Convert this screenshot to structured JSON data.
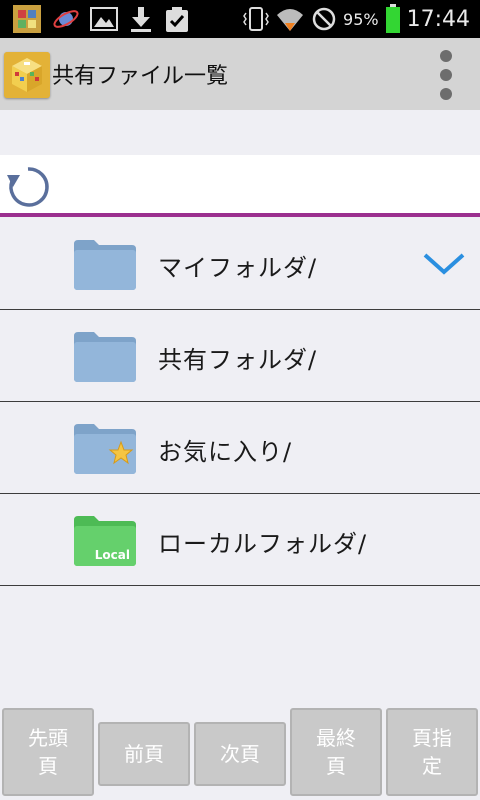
{
  "status": {
    "battery_pct": "95%",
    "time": "17:44"
  },
  "header": {
    "title": "共有ファイル一覧"
  },
  "folders": [
    {
      "label": "マイフォルダ/",
      "icon": "folder-blue",
      "selected": true
    },
    {
      "label": "共有フォルダ/",
      "icon": "folder-blue"
    },
    {
      "label": "お気に入り/",
      "icon": "folder-star"
    },
    {
      "label": "ローカルフォルダ/",
      "icon": "folder-green-local",
      "icon_text": "Local"
    }
  ],
  "pager": {
    "first": "先頭\n頁",
    "prev": "前頁",
    "next": "次頁",
    "last": "最終\n頁",
    "goto": "頁指\n定"
  },
  "colors": {
    "accent_line": "#9b2f8f",
    "check_blue": "#2a8fe0",
    "action_bar": "#d4d4d4"
  }
}
